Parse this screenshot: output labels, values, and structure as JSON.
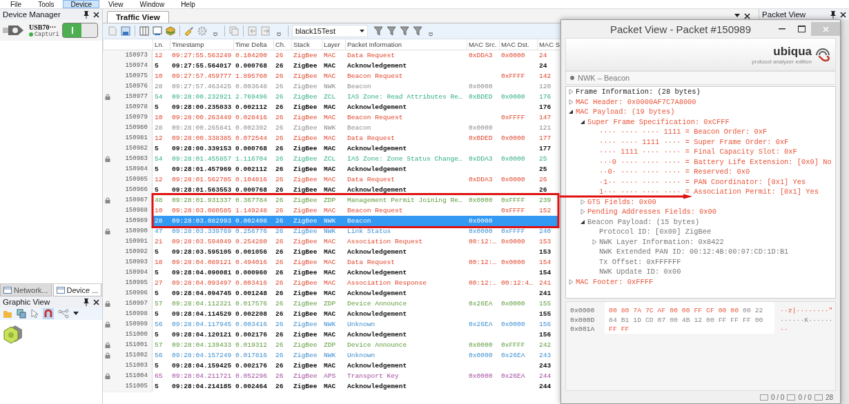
{
  "menu": [
    {
      "label": "File",
      "selected": false
    },
    {
      "label": "Tools",
      "selected": false
    },
    {
      "label": "Device",
      "selected": true
    },
    {
      "label": "View",
      "selected": false
    },
    {
      "label": "Window",
      "selected": false
    },
    {
      "label": "Help",
      "selected": false
    }
  ],
  "device_manager": {
    "title": "Device Manager",
    "device": {
      "name": "USB70···",
      "status": "Capturi",
      "on": true
    }
  },
  "left_tabs": [
    {
      "label": "Network...",
      "selected": false
    },
    {
      "label": "Device ...",
      "selected": true
    }
  ],
  "graphic_view": {
    "title": "Graphic View"
  },
  "traffic_view": {
    "tab": "Traffic View",
    "filter": "black15Test",
    "columns": [
      "",
      "Ln.",
      "Timestamp",
      "Time Delta",
      "Ch.",
      "Stack",
      "Layer",
      "Packet Information",
      "MAC Src.",
      "MAC Dst.",
      "MAC S"
    ],
    "rows": [
      {
        "id": "150973",
        "ln": "12",
        "time": "09:27:55.563249",
        "delta": "0.104200",
        "ch": "26",
        "stack": "ZigBee",
        "layer": "MAC",
        "info": "Data Request",
        "src": "0xDDA3",
        "dst": "0x0000",
        "size": "24",
        "kind": "mac",
        "locked": false,
        "selected": false
      },
      {
        "id": "150974",
        "ln": "5",
        "time": "09:27:55.564017",
        "delta": "0.000768",
        "ch": "26",
        "stack": "ZigBee",
        "layer": "MAC",
        "info": "Acknowledgement",
        "size": "24",
        "kind": "ack",
        "locked": false,
        "selected": false
      },
      {
        "id": "150975",
        "ln": "10",
        "time": "09:27:57.459777",
        "delta": "1.895760",
        "ch": "26",
        "stack": "ZigBee",
        "layer": "MAC",
        "info": "Beacon Request",
        "dst": "0xFFFF",
        "size": "142",
        "kind": "mac",
        "locked": false,
        "selected": false
      },
      {
        "id": "150976",
        "ln": "28",
        "time": "09:27:57.463425",
        "delta": "0.003648",
        "ch": "26",
        "stack": "ZigBee",
        "layer": "NWK",
        "info": "Beacon",
        "src": "0x0000",
        "size": "120",
        "kind": "beacon",
        "locked": false,
        "selected": false
      },
      {
        "id": "150977",
        "ln": "54",
        "time": "09:28:00.232921",
        "delta": "2.769496",
        "ch": "26",
        "stack": "ZigBee",
        "layer": "ZCL",
        "info": "IAS Zone: Read Attributes Re…",
        "src": "0xBDED",
        "dst": "0x0000",
        "size": "176",
        "kind": "zcl",
        "locked": true,
        "selected": false
      },
      {
        "id": "150978",
        "ln": "5",
        "time": "09:28:00.235033",
        "delta": "0.002112",
        "ch": "26",
        "stack": "ZigBee",
        "layer": "MAC",
        "info": "Acknowledgement",
        "size": "176",
        "kind": "ack",
        "locked": false,
        "selected": false
      },
      {
        "id": "150979",
        "ln": "10",
        "time": "09:28:00.263449",
        "delta": "0.028416",
        "ch": "26",
        "stack": "ZigBee",
        "layer": "MAC",
        "info": "Beacon Request",
        "dst": "0xFFFF",
        "size": "147",
        "kind": "mac",
        "locked": false,
        "selected": false
      },
      {
        "id": "150980",
        "ln": "28",
        "time": "09:28:00.265841",
        "delta": "0.002392",
        "ch": "26",
        "stack": "ZigBee",
        "layer": "NWK",
        "info": "Beacon",
        "src": "0x0000",
        "size": "121",
        "kind": "beacon",
        "locked": false,
        "selected": false
      },
      {
        "id": "150981",
        "ln": "12",
        "time": "09:28:00.338385",
        "delta": "0.072544",
        "ch": "26",
        "stack": "ZigBee",
        "layer": "MAC",
        "info": "Data Request",
        "src": "0xBDED",
        "dst": "0x0000",
        "size": "177",
        "kind": "mac",
        "locked": false,
        "selected": false
      },
      {
        "id": "150982",
        "ln": "5",
        "time": "09:28:00.339153",
        "delta": "0.000768",
        "ch": "26",
        "stack": "ZigBee",
        "layer": "MAC",
        "info": "Acknowledgement",
        "size": "177",
        "kind": "ack",
        "locked": false,
        "selected": false
      },
      {
        "id": "150983",
        "ln": "54",
        "time": "09:28:01.455857",
        "delta": "1.116704",
        "ch": "26",
        "stack": "ZigBee",
        "layer": "ZCL",
        "info": "IAS Zone: Zone Status Change…",
        "src": "0xDDA3",
        "dst": "0x0000",
        "size": "25",
        "kind": "zcl",
        "locked": true,
        "selected": false
      },
      {
        "id": "150984",
        "ln": "5",
        "time": "09:28:01.457969",
        "delta": "0.002112",
        "ch": "26",
        "stack": "ZigBee",
        "layer": "MAC",
        "info": "Acknowledgement",
        "size": "25",
        "kind": "ack",
        "locked": false,
        "selected": false
      },
      {
        "id": "150985",
        "ln": "12",
        "time": "09:28:01.562785",
        "delta": "0.104816",
        "ch": "26",
        "stack": "ZigBee",
        "layer": "MAC",
        "info": "Data Request",
        "src": "0xDDA3",
        "dst": "0x0000",
        "size": "26",
        "kind": "mac",
        "locked": false,
        "selected": false
      },
      {
        "id": "150986",
        "ln": "5",
        "time": "09:28:01.563553",
        "delta": "0.000768",
        "ch": "26",
        "stack": "ZigBee",
        "layer": "MAC",
        "info": "Acknowledgement",
        "size": "26",
        "kind": "ack",
        "locked": false,
        "selected": false
      },
      {
        "id": "150987",
        "ln": "48",
        "time": "09:28:01.931337",
        "delta": "0.367784",
        "ch": "26",
        "stack": "ZigBee",
        "layer": "ZDP",
        "info": "Management Permit Joining Re…",
        "src": "0x0000",
        "dst": "0xFFFF",
        "size": "239",
        "kind": "zdp",
        "locked": true,
        "selected": false
      },
      {
        "id": "150988",
        "ln": "10",
        "time": "09:28:03.080585",
        "delta": "1.149248",
        "ch": "26",
        "stack": "ZigBee",
        "layer": "MAC",
        "info": "Beacon Request",
        "dst": "0xFFFF",
        "size": "152",
        "kind": "mac",
        "locked": false,
        "selected": false
      },
      {
        "id": "150989",
        "ln": "28",
        "time": "09:28:03.082993",
        "delta": "0.002408",
        "ch": "26",
        "stack": "ZigBee",
        "layer": "NWK",
        "info": "Beacon",
        "src": "0x0000",
        "kind": "beacon",
        "locked": false,
        "selected": true
      },
      {
        "id": "150990",
        "ln": "47",
        "time": "09:28:03.339769",
        "delta": "0.256776",
        "ch": "26",
        "stack": "ZigBee",
        "layer": "NWK",
        "info": "Link Status",
        "src": "0x0000",
        "dst": "0xFFFF",
        "size": "240",
        "kind": "nwk",
        "locked": true,
        "selected": false
      },
      {
        "id": "150991",
        "ln": "21",
        "time": "09:28:03.594049",
        "delta": "0.254280",
        "ch": "26",
        "stack": "ZigBee",
        "layer": "MAC",
        "info": "Association Request",
        "src": "00:12:…",
        "dst": "0x0000",
        "size": "153",
        "kind": "mac",
        "locked": false,
        "selected": false
      },
      {
        "id": "150992",
        "ln": "5",
        "time": "09:28:03.595105",
        "delta": "0.001056",
        "ch": "26",
        "stack": "ZigBee",
        "layer": "MAC",
        "info": "Acknowledgement",
        "size": "153",
        "kind": "ack",
        "locked": false,
        "selected": false
      },
      {
        "id": "150993",
        "ln": "18",
        "time": "09:28:04.089121",
        "delta": "0.494016",
        "ch": "26",
        "stack": "ZigBee",
        "layer": "MAC",
        "info": "Data Request",
        "src": "00:12:…",
        "dst": "0x0000",
        "size": "154",
        "kind": "mac",
        "locked": false,
        "selected": false
      },
      {
        "id": "150994",
        "ln": "5",
        "time": "09:28:04.090081",
        "delta": "0.000960",
        "ch": "26",
        "stack": "ZigBee",
        "layer": "MAC",
        "info": "Acknowledgement",
        "size": "154",
        "kind": "ack",
        "locked": false,
        "selected": false
      },
      {
        "id": "150995",
        "ln": "27",
        "time": "09:28:04.093497",
        "delta": "0.003416",
        "ch": "26",
        "stack": "ZigBee",
        "layer": "MAC",
        "info": "Association Response",
        "src": "00:12:…",
        "dst": "00:12:4…",
        "size": "241",
        "kind": "mac",
        "locked": false,
        "selected": false
      },
      {
        "id": "150996",
        "ln": "5",
        "time": "09:28:04.094745",
        "delta": "0.001248",
        "ch": "26",
        "stack": "ZigBee",
        "layer": "MAC",
        "info": "Acknowledgement",
        "size": "241",
        "kind": "ack",
        "locked": false,
        "selected": false
      },
      {
        "id": "150997",
        "ln": "57",
        "time": "09:28:04.112321",
        "delta": "0.017576",
        "ch": "26",
        "stack": "ZigBee",
        "layer": "ZDP",
        "info": "Device Announce",
        "src": "0x26EA",
        "dst": "0x0000",
        "size": "155",
        "kind": "zdp",
        "locked": true,
        "selected": false
      },
      {
        "id": "150998",
        "ln": "5",
        "time": "09:28:04.114529",
        "delta": "0.002208",
        "ch": "26",
        "stack": "ZigBee",
        "layer": "MAC",
        "info": "Acknowledgement",
        "size": "155",
        "kind": "ack",
        "locked": false,
        "selected": false
      },
      {
        "id": "150999",
        "ln": "56",
        "time": "09:28:04.117945",
        "delta": "0.003416",
        "ch": "26",
        "stack": "ZigBee",
        "layer": "NWK",
        "info": "Unknown",
        "src": "0x26EA",
        "dst": "0x0000",
        "size": "156",
        "kind": "nwk",
        "locked": true,
        "selected": false
      },
      {
        "id": "151000",
        "ln": "5",
        "time": "09:28:04.120121",
        "delta": "0.002176",
        "ch": "26",
        "stack": "ZigBee",
        "layer": "MAC",
        "info": "Acknowledgement",
        "size": "156",
        "kind": "ack",
        "locked": false,
        "selected": false
      },
      {
        "id": "151001",
        "ln": "57",
        "time": "09:28:04.139433",
        "delta": "0.019312",
        "ch": "26",
        "stack": "ZigBee",
        "layer": "ZDP",
        "info": "Device Announce",
        "src": "0x0000",
        "dst": "0xFFFF",
        "size": "242",
        "kind": "zdp",
        "locked": true,
        "selected": false
      },
      {
        "id": "151002",
        "ln": "56",
        "time": "09:28:04.157249",
        "delta": "0.017816",
        "ch": "26",
        "stack": "ZigBee",
        "layer": "NWK",
        "info": "Unknown",
        "src": "0x0000",
        "dst": "0x26EA",
        "size": "243",
        "kind": "nwk",
        "locked": true,
        "selected": false
      },
      {
        "id": "151003",
        "ln": "5",
        "time": "09:28:04.159425",
        "delta": "0.002176",
        "ch": "26",
        "stack": "ZigBee",
        "layer": "MAC",
        "info": "Acknowledgement",
        "size": "243",
        "kind": "ack",
        "locked": false,
        "selected": false
      },
      {
        "id": "151004",
        "ln": "65",
        "time": "09:28:04.211721",
        "delta": "0.052296",
        "ch": "26",
        "stack": "ZigBee",
        "layer": "APS",
        "info": "Transport Key",
        "src": "0x0000",
        "dst": "0x26EA",
        "size": "244",
        "kind": "aps",
        "locked": true,
        "selected": false
      },
      {
        "id": "151005",
        "ln": "5",
        "time": "09:28:04.214185",
        "delta": "0.002464",
        "ch": "26",
        "stack": "ZigBee",
        "layer": "MAC",
        "info": "Acknowledgement",
        "size": "244",
        "kind": "ack",
        "locked": false,
        "selected": false
      }
    ]
  },
  "packet_view_dock": {
    "title": "Packet View"
  },
  "packet_window": {
    "title": "Packet View - Packet #150989",
    "logo": "ubiqua",
    "logo_sub": "protocol analyzer edition",
    "summary": "NWK – Beacon",
    "tree": [
      {
        "label": "Frame Information: (28 bytes)",
        "color": "#222222",
        "expanded": false
      },
      {
        "label": "MAC Header: 0x0000AF7C7A8000",
        "color": "#e8553a",
        "expanded": false
      },
      {
        "label": "MAC Payload: (19 bytes)",
        "color": "#e8553a",
        "expanded": true,
        "children": [
          {
            "label": "Super Frame Specification: 0xCFFF",
            "color": "#e8553a",
            "expanded": true,
            "children": [
              {
                "label": "···· ···· ···· 1111 = Beacon Order: 0xF",
                "color": "#e8553a"
              },
              {
                "label": "···· ···· 1111 ···· = Super Frame Order: 0xF",
                "color": "#e8553a"
              },
              {
                "label": "···· 1111 ···· ···· = Final Capacity Slot: 0xF",
                "color": "#e8553a"
              },
              {
                "label": "···0 ···· ···· ···· = Battery Life Extension: [0x0] No",
                "color": "#e8553a"
              },
              {
                "label": "··0· ···· ···· ···· = Reserved: 0x0",
                "color": "#e8553a"
              },
              {
                "label": "·1·· ···· ···· ···· = PAN Coordinator: [0x1] Yes",
                "color": "#e8553a"
              },
              {
                "label": "1··· ···· ···· ···· = Association Permit: [0x1] Yes",
                "color": "#e8553a"
              }
            ]
          },
          {
            "label": "GTS Fields: 0x00",
            "color": "#e8553a",
            "expanded": false
          },
          {
            "label": "Pending Addresses Fields: 0x00",
            "color": "#e8553a",
            "expanded": false
          },
          {
            "label": "Beacon Payload: (15 bytes)",
            "color": "#777777",
            "expanded": true,
            "children": [
              {
                "label": "Protocol ID: [0x00] ZigBee",
                "color": "#777777"
              },
              {
                "label": "NWK Layer Information: 0x8422",
                "color": "#777777",
                "expanded": false
              },
              {
                "label": "NWK Extended PAN ID: 00:12:4B:00:07:CD:1D:B1",
                "color": "#777777"
              },
              {
                "label": "Tx Offset: 0xFFFFFF",
                "color": "#777777"
              },
              {
                "label": "NWK Update ID: 0x00",
                "color": "#777777"
              }
            ]
          }
        ]
      },
      {
        "label": "MAC Footer: 0xFFFF",
        "color": "#e8553a",
        "expanded": false
      }
    ],
    "hex": [
      {
        "offset": "0x0000",
        "bytes": [
          {
            "text": "00 80 7A 7C AF 00 00 FF CF 00 00",
            "highlighted": true
          },
          {
            "text": "00 22",
            "highlighted": false
          }
        ],
        "ascii": "··z|········\"",
        "ascii_highlighted": true
      },
      {
        "offset": "0x000D",
        "bytes": [
          {
            "text": "84 B1 1D CD 07 00 4B 12 00 FF FF FF 00",
            "highlighted": false
          }
        ],
        "ascii": "······K······",
        "ascii_highlighted": false
      },
      {
        "offset": "0x001A",
        "bytes": [
          {
            "text": "FF FF",
            "highlighted": true
          }
        ],
        "ascii": "··",
        "ascii_highlighted": true
      }
    ],
    "status": [
      "0 / 0",
      "0 / 0",
      "28"
    ]
  }
}
